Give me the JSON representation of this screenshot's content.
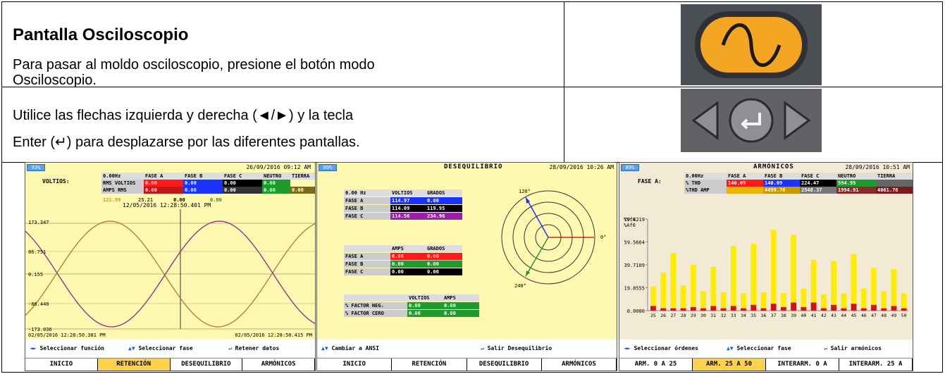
{
  "header": {
    "title": "Pantalla Osciloscopio",
    "line1": "Para pasar al moldo osciloscopio, presione el botón modo",
    "line2": "Osciloscopio.",
    "nav1": "Utilice las flechas izquierda y derecha (◄/►) y la tecla",
    "nav2": "Enter (↵) para desplazarse por las diferentes pantallas."
  },
  "icons": {
    "scope": "sine-wave-button-icon",
    "nav": "arrow-enter-keys-icon"
  },
  "colors": {
    "yellow_bg": "#fff8b0",
    "tab_selected": "#ffd24a",
    "red": "#ff1a1a",
    "blue": "#1a33ff",
    "black": "#000000",
    "green": "#1f9a2f",
    "purple": "#9b1fa8"
  },
  "scope": {
    "battery": "93%",
    "date": "26/09/2016 09:12 AM",
    "row_label": "VOLTIOS:",
    "head": [
      "0.00Hz",
      "FASE A",
      "FASE B",
      "FASE C",
      "NEUTRO",
      "TIERRA"
    ],
    "r1_label": "RMS VOLTIOS",
    "r1": [
      "0.00",
      "0.00",
      "0.00",
      "0.00"
    ],
    "r2_label": "AMPS RMS",
    "r2": [
      "0.00",
      "0.00",
      "0.00",
      "0.00",
      "0.00"
    ],
    "vals": [
      "121.89",
      "25.21",
      "0.00",
      "0.00"
    ],
    "stamp": "12/05/2016  12:28:50.401 PM",
    "yt": [
      "173.347",
      "86.751",
      "0.155",
      "-86.440",
      "-173.036"
    ],
    "xl": "02/05/2016 12:28:50.381 PM",
    "xr": "02/05/2016 12:28:50.415 PM",
    "help": [
      "Seleccionar función",
      "Seleccionar fase",
      "Retener datos"
    ],
    "tabs": [
      "INICIO",
      "RETENCIÓN",
      "DESEQUILIBRIO",
      "ARMÓNICOS"
    ]
  },
  "deseq": {
    "battery": "89%",
    "title": "DESEQUILIBRIO",
    "date": "28/09/2016 10:26 AM",
    "t1": {
      "h": [
        "0.00 Hz",
        "VOLTIOS",
        "GRADOS"
      ],
      "rows": [
        [
          "FASE A",
          "114.97",
          "0.00"
        ],
        [
          "FASE B",
          "114.09",
          "119.95"
        ],
        [
          "FASE C",
          "114.56",
          "234.96"
        ]
      ]
    },
    "t2": {
      "h": [
        "",
        "AMPS",
        "GRADOS"
      ],
      "rows": [
        [
          "FASE A",
          "0.00",
          "0.00"
        ],
        [
          "FASE B",
          "0.00",
          "0.00"
        ],
        [
          "FASE C",
          "0.00",
          "0.00"
        ]
      ]
    },
    "t3": {
      "h": [
        "",
        "VOLTIOS",
        "AMPS"
      ],
      "rows": [
        [
          "% FACTOR NEG.",
          "0.00",
          "0.00"
        ],
        [
          "% FACTOR CERO",
          "0.00",
          "0.00"
        ]
      ]
    },
    "angles": [
      "120°",
      "0°",
      "240°"
    ],
    "help": [
      "Cambiar a ANSI",
      "Salir Desequilibrio"
    ],
    "tabs": [
      "INICIO",
      "RETENCIÓN",
      "DESEQUILIBRIO",
      "ARMÓNICOS"
    ]
  },
  "arm": {
    "battery": "89%",
    "title": "ARMÓNICOS",
    "date": "28/09/2016 10:51 AM",
    "row_label": "FASE A:",
    "head": [
      "0.00Hz",
      "FASE A",
      "FASE B",
      "FASE C",
      "NEUTRO",
      "TIERRA"
    ],
    "r1_label": "% THD",
    "r1": [
      "140.09",
      "140.09",
      "224.47",
      "594.95"
    ],
    "r2_label": "%THD AMP",
    "r2": [
      "",
      "4499.78",
      "2548.37",
      "1994.91",
      "4061.76"
    ],
    "leg1": "%Vf0",
    "leg2": "%Af0",
    "help": [
      "Seleccionar órdenes",
      "Seleccionar fase",
      "Salir armónicos"
    ],
    "tabs": [
      "ARM. 0 A 25",
      "ARM. 25 A 50",
      "INTERARM. 0 A",
      "INTERARM. 25 A"
    ]
  },
  "chart_data": {
    "type": "bar",
    "title": "ARMÓNICOS",
    "categories": [
      "25",
      "26",
      "27",
      "28",
      "29",
      "30",
      "31",
      "32",
      "33",
      "34",
      "35",
      "36",
      "37",
      "38",
      "39",
      "40",
      "41",
      "42",
      "43",
      "44",
      "45",
      "46",
      "47",
      "48",
      "49",
      "50"
    ],
    "series": [
      {
        "name": "%Vf0",
        "values": [
          21,
          33,
          50,
          22,
          40,
          17,
          38,
          16,
          56,
          15,
          58,
          16,
          70,
          15,
          66,
          19,
          44,
          14,
          43,
          15,
          49,
          19,
          37,
          17,
          36,
          15
        ]
      },
      {
        "name": "%Af0",
        "values": [
          4,
          2,
          2,
          2,
          3,
          2,
          4,
          2,
          4,
          2,
          5,
          2,
          6,
          3,
          7,
          3,
          7,
          2,
          5,
          2,
          6,
          2,
          5,
          2,
          4,
          2
        ]
      }
    ],
    "ylim": [
      0,
      79.4219
    ],
    "yticks": [
      "79.4219",
      "59.5664",
      "39.7109",
      "19.8555",
      "0.0000"
    ]
  }
}
